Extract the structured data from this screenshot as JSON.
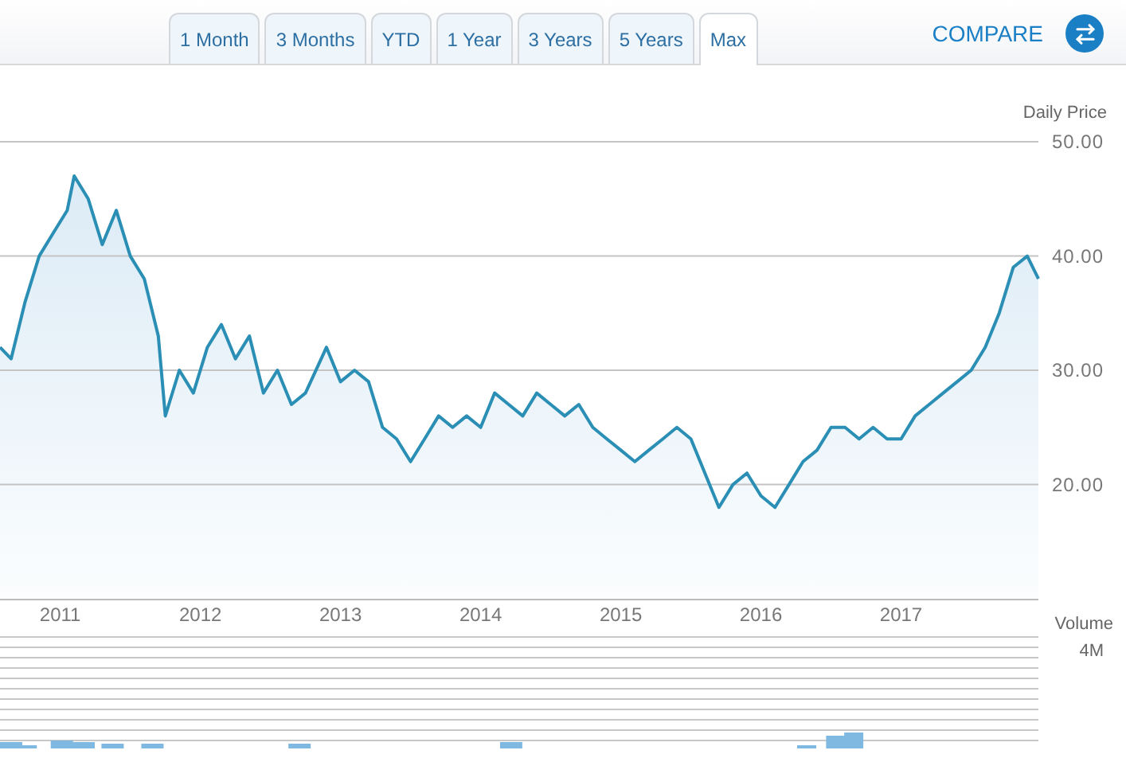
{
  "range_tabs": [
    {
      "label": "1 Month",
      "selected": false
    },
    {
      "label": "3 Months",
      "selected": false
    },
    {
      "label": "YTD",
      "selected": false
    },
    {
      "label": "1 Year",
      "selected": false
    },
    {
      "label": "3 Years",
      "selected": false
    },
    {
      "label": "5 Years",
      "selected": false
    },
    {
      "label": "Max",
      "selected": true
    }
  ],
  "compare": {
    "label": "COMPARE"
  },
  "price_chart": {
    "chart_data": {
      "type": "area",
      "ylabel": "Daily Price",
      "xlim": [
        2010.57,
        2017.98
      ],
      "ylim": [
        10,
        50
      ],
      "grid": true,
      "yticks": [
        {
          "value": 20,
          "label": "20.00"
        },
        {
          "value": 30,
          "label": "30.00"
        },
        {
          "value": 40,
          "label": "40.00"
        },
        {
          "value": 50,
          "label": "50.00"
        }
      ],
      "xticks": [
        {
          "value": 2011,
          "label": "2011"
        },
        {
          "value": 2012,
          "label": "2012"
        },
        {
          "value": 2013,
          "label": "2013"
        },
        {
          "value": 2014,
          "label": "2014"
        },
        {
          "value": 2015,
          "label": "2015"
        },
        {
          "value": 2016,
          "label": "2016"
        },
        {
          "value": 2017,
          "label": "2017"
        }
      ],
      "x": [
        2010.57,
        2010.65,
        2010.75,
        2010.85,
        2010.95,
        2011.05,
        2011.1,
        2011.2,
        2011.3,
        2011.4,
        2011.5,
        2011.6,
        2011.7,
        2011.75,
        2011.85,
        2011.95,
        2012.05,
        2012.15,
        2012.25,
        2012.35,
        2012.45,
        2012.55,
        2012.65,
        2012.75,
        2012.9,
        2013.0,
        2013.1,
        2013.2,
        2013.3,
        2013.4,
        2013.5,
        2013.6,
        2013.7,
        2013.8,
        2013.9,
        2014.0,
        2014.1,
        2014.2,
        2014.3,
        2014.4,
        2014.5,
        2014.6,
        2014.7,
        2014.8,
        2014.9,
        2015.0,
        2015.1,
        2015.2,
        2015.3,
        2015.4,
        2015.5,
        2015.6,
        2015.7,
        2015.8,
        2015.9,
        2016.0,
        2016.1,
        2016.2,
        2016.3,
        2016.4,
        2016.5,
        2016.6,
        2016.7,
        2016.8,
        2016.9,
        2017.0,
        2017.1,
        2017.2,
        2017.3,
        2017.4,
        2017.5,
        2017.6,
        2017.7,
        2017.8,
        2017.9,
        2017.98
      ],
      "series": [
        {
          "color": "#2b8fb5",
          "values": [
            32,
            31,
            36,
            40,
            42,
            44,
            47,
            45,
            41,
            44,
            40,
            38,
            33,
            26,
            30,
            28,
            32,
            34,
            31,
            33,
            28,
            30,
            27,
            28,
            32,
            29,
            30,
            29,
            25,
            24,
            22,
            24,
            26,
            25,
            26,
            25,
            28,
            27,
            26,
            28,
            27,
            26,
            27,
            25,
            24,
            23,
            22,
            23,
            24,
            25,
            24,
            21,
            18,
            20,
            21,
            19,
            18,
            20,
            22,
            23,
            25,
            25,
            24,
            25,
            24,
            24,
            26,
            27,
            28,
            29,
            30,
            32,
            35,
            39,
            40,
            38
          ]
        }
      ]
    }
  },
  "volume": {
    "label": "Volume",
    "scale_label": "4M"
  }
}
